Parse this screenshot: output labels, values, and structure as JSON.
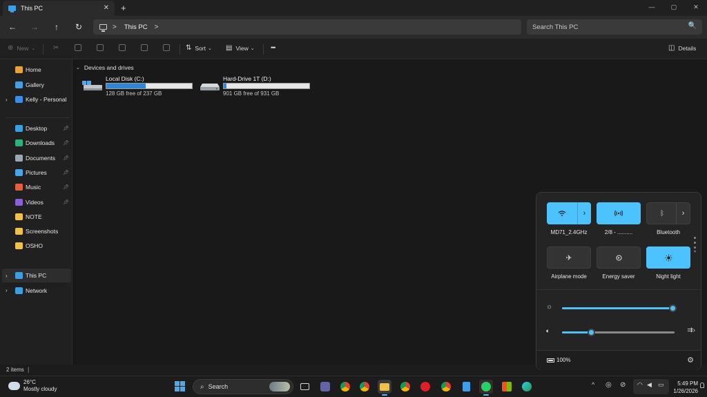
{
  "tab": {
    "title": "This PC",
    "close": "✕",
    "new": "+"
  },
  "window_controls": {
    "minimize": "—",
    "maximize": "▢",
    "close": "✕"
  },
  "nav": {
    "back": "←",
    "forward": "→",
    "up": "↑",
    "refresh": "↻"
  },
  "address": {
    "crumbs": [
      "This PC"
    ],
    "sep": ">"
  },
  "search": {
    "placeholder": "Search This PC",
    "icon": "🔍"
  },
  "commands": {
    "new": "New",
    "sort": "Sort",
    "view": "View",
    "more": "•••",
    "details": "Details"
  },
  "sidebar": {
    "top": [
      {
        "label": "Home",
        "color": "#e8a23a"
      },
      {
        "label": "Gallery",
        "color": "#46a0e0"
      },
      {
        "label": "Kelly - Personal",
        "color": "#3b8ee8",
        "expandable": true
      }
    ],
    "pinned": [
      {
        "label": "Desktop",
        "color": "#3a9ee0"
      },
      {
        "label": "Downloads",
        "color": "#2bb37a"
      },
      {
        "label": "Documents",
        "color": "#9aa7b5"
      },
      {
        "label": "Pictures",
        "color": "#4aa6e8"
      },
      {
        "label": "Music",
        "color": "#e5603f"
      },
      {
        "label": "Videos",
        "color": "#8a5fd8"
      }
    ],
    "folders": [
      {
        "label": "NOTE",
        "color": "#f2c04a"
      },
      {
        "label": "Screenshots",
        "color": "#f2c04a"
      },
      {
        "label": "OSHO",
        "color": "#f2c04a"
      }
    ],
    "bottom": [
      {
        "label": "This PC",
        "color": "#3a9ee0",
        "active": true
      },
      {
        "label": "Network",
        "color": "#3a9ee0"
      }
    ]
  },
  "content": {
    "group": "Devices and drives",
    "drives": [
      {
        "name": "Local Disk (C:)",
        "free": "128 GB free of 237 GB",
        "used_fraction": 0.46
      },
      {
        "name": "Hard-Drive 1T (D:)",
        "free": "901 GB free of 931 GB",
        "used_fraction": 0.03
      }
    ]
  },
  "status": {
    "count": "2 items",
    "pipe": "|"
  },
  "quick_settings": {
    "tiles": [
      {
        "label": "MD71_2.4GHz",
        "state": "on",
        "icon": "wifi-icon"
      },
      {
        "label": "2/8 - ..........",
        "state": "on",
        "icon": "hotspot-icon"
      },
      {
        "label": "Bluetooth",
        "state": "off",
        "icon": "bluetooth-icon"
      },
      {
        "label": "Airplane mode",
        "state": "off",
        "icon": "airplane-icon"
      },
      {
        "label": "Energy saver",
        "state": "off",
        "icon": "energy-saver-icon"
      },
      {
        "label": "Night light",
        "state": "on",
        "icon": "night-light-icon"
      }
    ],
    "brightness": 0.98,
    "volume": 0.26,
    "battery": "100%"
  },
  "taskbar": {
    "weather_temp": "26°C",
    "weather_desc": "Mostly cloudy",
    "search_label": "Search",
    "time": "5:49 PM",
    "date": "1/26/2026"
  },
  "colors": {
    "accent": "#4cc2ff",
    "drive_fill": "#2f86d6"
  }
}
